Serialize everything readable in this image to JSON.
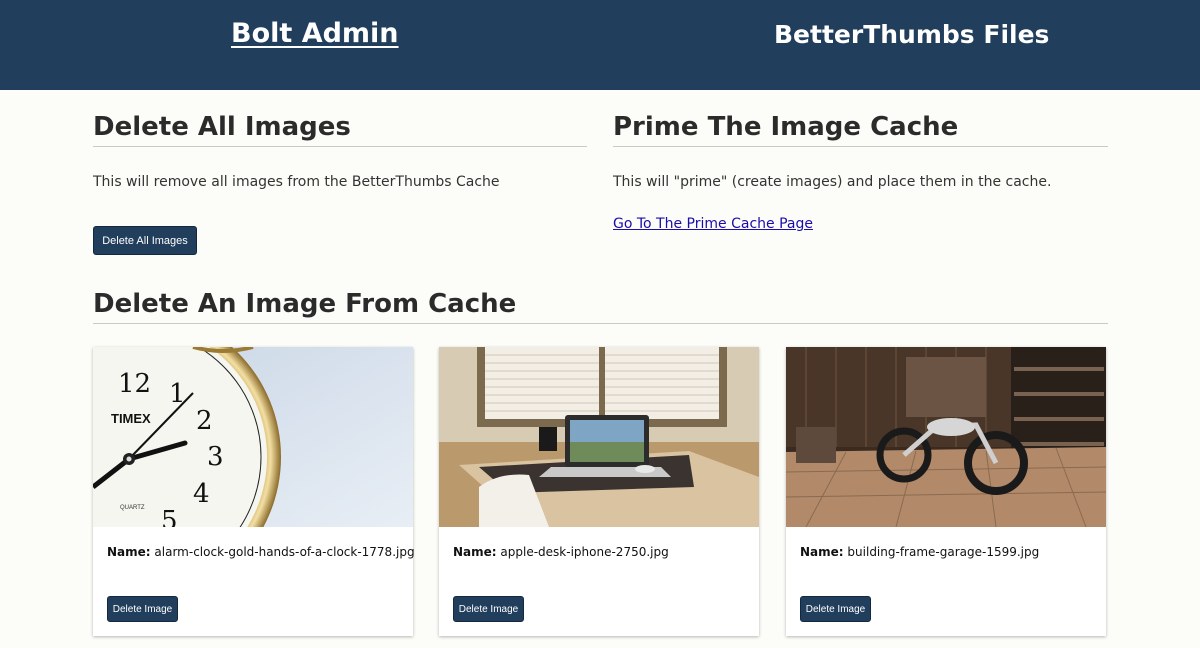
{
  "header": {
    "brand": "Bolt Admin",
    "page_title": "BetterThumbs Files"
  },
  "delete_all": {
    "heading": "Delete All Images",
    "description": "This will remove all images from the BetterThumbs Cache",
    "button_label": "Delete All Images"
  },
  "prime": {
    "heading": "Prime The Image Cache",
    "description": "This will \"prime\" (create images) and place them in the cache.",
    "link_label": "Go To The Prime Cache Page"
  },
  "delete_one": {
    "heading": "Delete An Image From Cache",
    "name_label": "Name:",
    "button_label": "Delete Image",
    "images": [
      {
        "filename": "alarm-clock-gold-hands-of-a-clock-1778.jpg",
        "clock_brand": "TIMEX",
        "clock_sub": "QUARTZ"
      },
      {
        "filename": "apple-desk-iphone-2750.jpg"
      },
      {
        "filename": "building-frame-garage-1599.jpg"
      }
    ]
  },
  "colors": {
    "header_bg": "#213e5c",
    "button_bg": "#213e5c",
    "page_bg": "#fcfcf8",
    "link": "#1a0dab"
  }
}
